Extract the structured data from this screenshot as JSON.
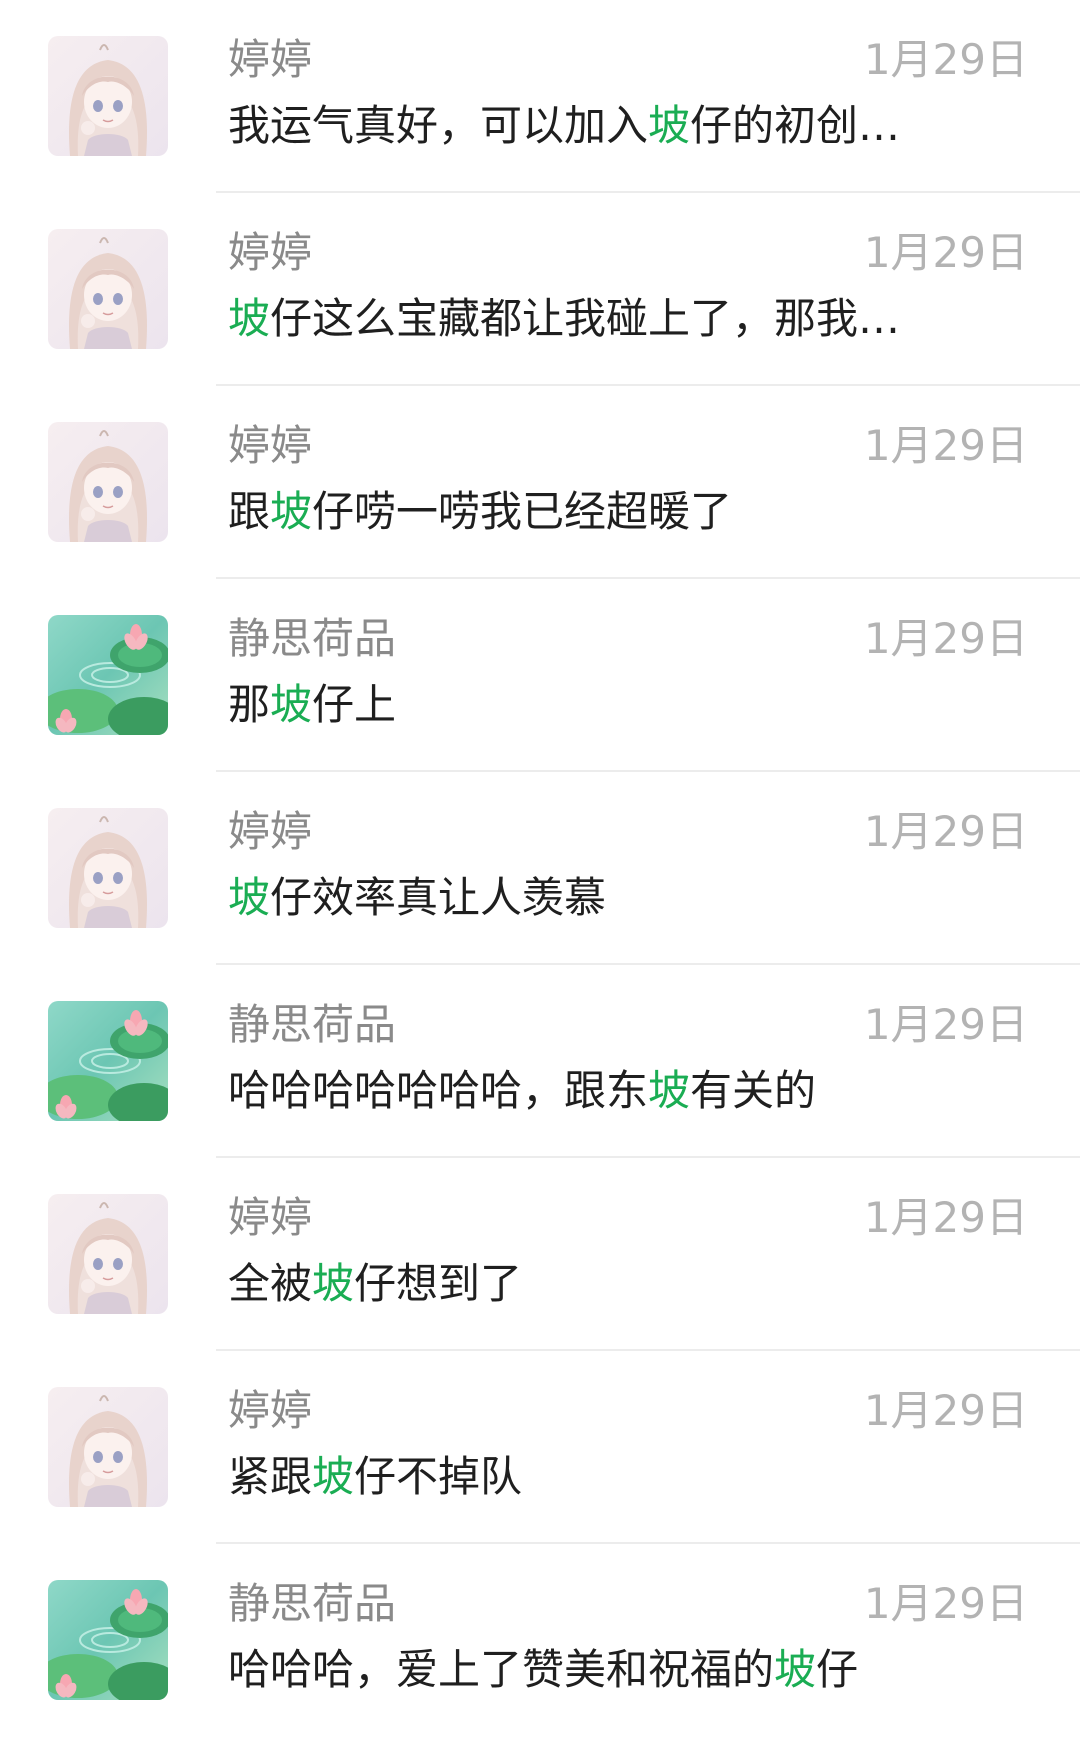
{
  "highlight_keyword": "坡",
  "highlight_color": "#1aad53",
  "messages": [
    {
      "sender": "婷婷",
      "avatar_icon": "girl-avatar-icon",
      "date": "1月29日",
      "text": "我运气真好，可以加入坡仔的初创…"
    },
    {
      "sender": "婷婷",
      "avatar_icon": "girl-avatar-icon",
      "date": "1月29日",
      "text": "坡仔这么宝藏都让我碰上了，那我…"
    },
    {
      "sender": "婷婷",
      "avatar_icon": "girl-avatar-icon",
      "date": "1月29日",
      "text": "跟坡仔唠一唠我已经超暖了"
    },
    {
      "sender": "静思荷品",
      "avatar_icon": "lotus-pond-avatar-icon",
      "date": "1月29日",
      "text": "那坡仔上"
    },
    {
      "sender": "婷婷",
      "avatar_icon": "girl-avatar-icon",
      "date": "1月29日",
      "text": "坡仔效率真让人羡慕"
    },
    {
      "sender": "静思荷品",
      "avatar_icon": "lotus-pond-avatar-icon",
      "date": "1月29日",
      "text": "哈哈哈哈哈哈哈，跟东坡有关的"
    },
    {
      "sender": "婷婷",
      "avatar_icon": "girl-avatar-icon",
      "date": "1月29日",
      "text": "全被坡仔想到了"
    },
    {
      "sender": "婷婷",
      "avatar_icon": "girl-avatar-icon",
      "date": "1月29日",
      "text": "紧跟坡仔不掉队"
    },
    {
      "sender": "静思荷品",
      "avatar_icon": "lotus-pond-avatar-icon",
      "date": "1月29日",
      "text": "哈哈哈，爱上了赞美和祝福的坡仔"
    }
  ]
}
